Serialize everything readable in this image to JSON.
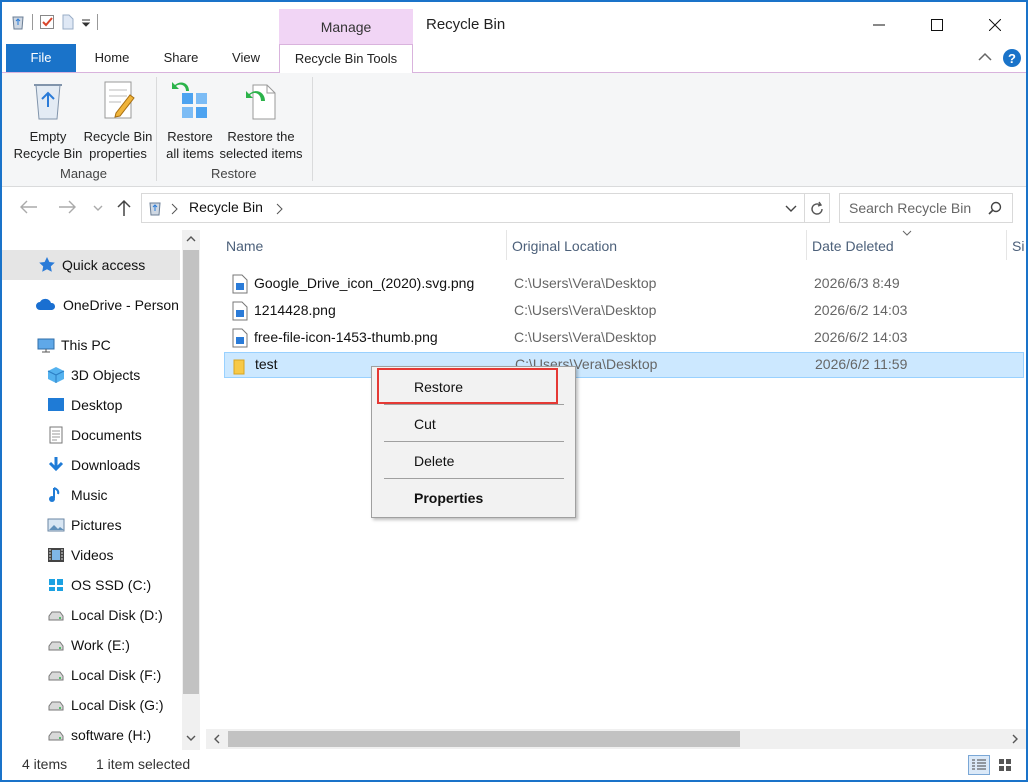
{
  "window": {
    "title": "Recycle Bin",
    "context_tab_header": "Manage"
  },
  "tabs": [
    {
      "label": "File"
    },
    {
      "label": "Home"
    },
    {
      "label": "Share"
    },
    {
      "label": "View"
    },
    {
      "label": "Recycle Bin Tools"
    }
  ],
  "ribbon": {
    "empty_l1": "Empty",
    "empty_l2": "Recycle Bin",
    "props_l1": "Recycle Bin",
    "props_l2": "properties",
    "restore_all_l1": "Restore",
    "restore_all_l2": "all items",
    "restore_sel_l1": "Restore the",
    "restore_sel_l2": "selected items",
    "group_manage": "Manage",
    "group_restore": "Restore"
  },
  "address": {
    "path": "Recycle Bin",
    "search_placeholder": "Search Recycle Bin"
  },
  "sidebar": {
    "items": [
      {
        "label": "Quick access",
        "icon": "star-icon"
      },
      {
        "label": "OneDrive - Person",
        "icon": "cloud-icon"
      },
      {
        "label": "This PC",
        "icon": "computer-icon"
      },
      {
        "label": "3D Objects",
        "icon": "cube-icon"
      },
      {
        "label": "Desktop",
        "icon": "desktop-icon"
      },
      {
        "label": "Documents",
        "icon": "document-icon"
      },
      {
        "label": "Downloads",
        "icon": "download-icon"
      },
      {
        "label": "Music",
        "icon": "music-icon"
      },
      {
        "label": "Pictures",
        "icon": "pictures-icon"
      },
      {
        "label": "Videos",
        "icon": "video-icon"
      },
      {
        "label": "OS SSD (C:)",
        "icon": "windows-drive-icon"
      },
      {
        "label": "Local Disk (D:)",
        "icon": "drive-icon"
      },
      {
        "label": "Work (E:)",
        "icon": "drive-icon"
      },
      {
        "label": "Local Disk (F:)",
        "icon": "drive-icon"
      },
      {
        "label": "Local Disk (G:)",
        "icon": "drive-icon"
      },
      {
        "label": "software (H:)",
        "icon": "drive-icon"
      }
    ]
  },
  "columns": {
    "name": "Name",
    "location": "Original Location",
    "date": "Date Deleted",
    "size": "Si"
  },
  "files": [
    {
      "name": "Google_Drive_icon_(2020).svg.png",
      "location": "C:\\Users\\Vera\\Desktop",
      "date": "2026/6/3 8:49"
    },
    {
      "name": "1214428.png",
      "location": "C:\\Users\\Vera\\Desktop",
      "date": "2026/6/2 14:03"
    },
    {
      "name": "free-file-icon-1453-thumb.png",
      "location": "C:\\Users\\Vera\\Desktop",
      "date": "2026/6/2 14:03"
    },
    {
      "name": "test",
      "location": "C:\\Users\\Vera\\Desktop",
      "date": "2026/6/2 11:59"
    }
  ],
  "context_menu": {
    "restore": "Restore",
    "cut": "Cut",
    "delete": "Delete",
    "properties": "Properties"
  },
  "status": {
    "count": "4 items",
    "selected": "1 item selected"
  },
  "colors": {
    "accent": "#1a73c9",
    "context_tab": "#f1d5f5",
    "selection": "#cce8ff",
    "highlight": "#e53935"
  }
}
